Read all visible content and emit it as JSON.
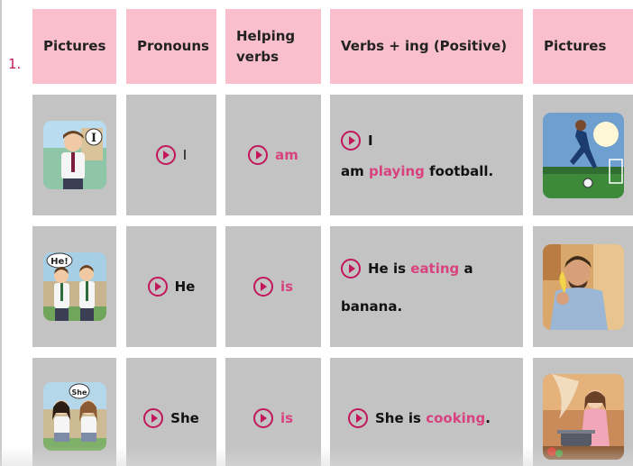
{
  "row_number": "1.",
  "headers": {
    "pictures_left": "Pictures",
    "pronouns": "Pronouns",
    "helping_verbs": "Helping verbs",
    "verbs_ing": "Verbs + ing (Positive)",
    "pictures_right": "Pictures"
  },
  "rows": [
    {
      "pronoun": "I",
      "helping_verb": "am",
      "sentence_line1": "I",
      "sentence_start": "am",
      "verb": "playing",
      "sentence_end": "football."
    },
    {
      "pronoun": "He",
      "helping_verb": "is",
      "sentence_start": "He is",
      "verb": "eating",
      "sentence_mid": "a",
      "sentence_end": "banana."
    },
    {
      "pronoun": "She",
      "helping_verb": "is",
      "sentence_start": "She is",
      "verb": "cooking",
      "sentence_end": "."
    }
  ],
  "colors": {
    "header_bg": "#f9bfcd",
    "cell_bg": "#c3c3c3",
    "accent": "#c2185b",
    "verb_pink": "#d8437f"
  },
  "icons": {
    "play": "play-circle-icon"
  }
}
